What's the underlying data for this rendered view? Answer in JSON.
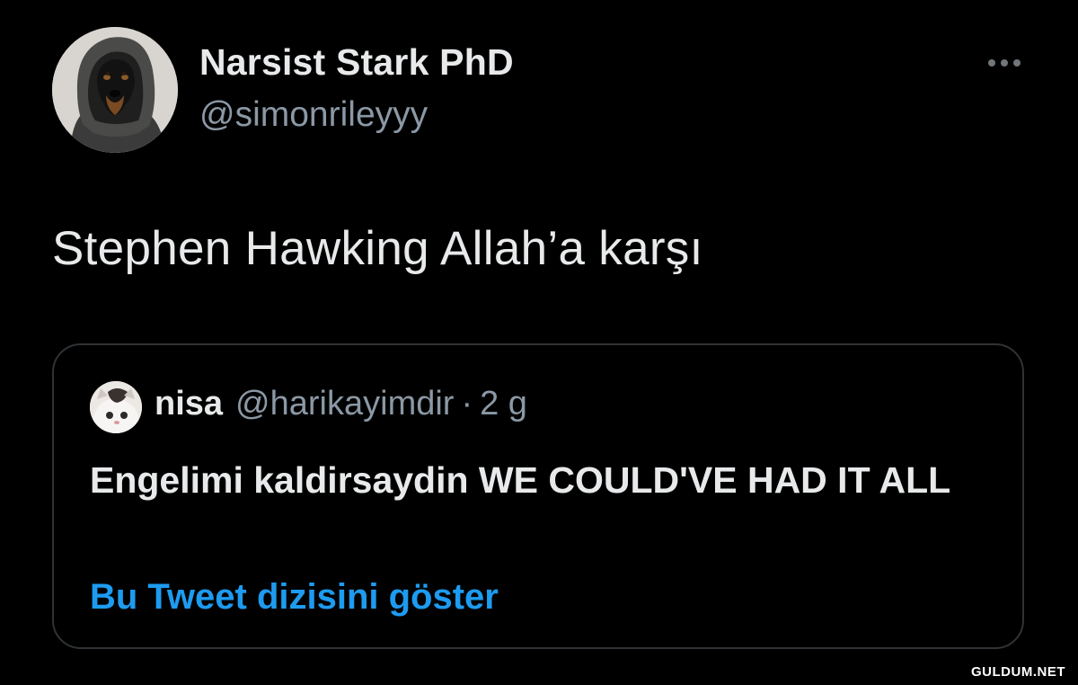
{
  "tweet": {
    "author": {
      "display_name": "Narsist Stark PhD",
      "handle": "@simonrileyyy",
      "avatar_icon": "hooded-dog-avatar"
    },
    "more_icon": "more-horizontal-icon",
    "text": "Stephen Hawking Allah’a karşı",
    "quoted": {
      "display_name": "nisa",
      "handle": "@harikayimdir",
      "separator": "·",
      "time": "2 g",
      "avatar_icon": "cat-avatar",
      "text": "Engelimi kaldirsaydin WE COULD'VE HAD IT ALL",
      "show_thread": "Bu Tweet dizisini göster"
    }
  },
  "watermark": "GULDUM.NET",
  "colors": {
    "background": "#000000",
    "text_primary": "#e7e9ea",
    "text_secondary": "#8b98a5",
    "link": "#1d9bf0",
    "border": "#2f3336"
  }
}
